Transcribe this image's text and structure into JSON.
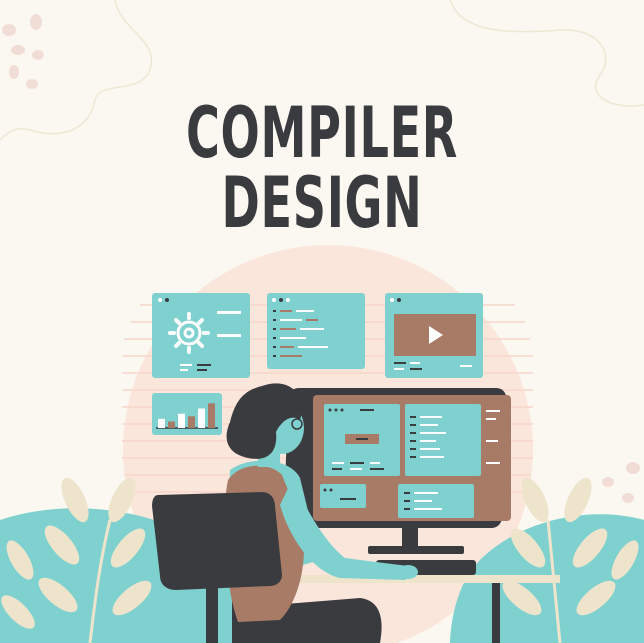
{
  "title": "COMPILER DESIGN",
  "colors": {
    "background": "#fbf8f1",
    "teal": "#7fd1cf",
    "brown": "#a77b66",
    "dark": "#3a3b3f",
    "blush": "#fbe6dc",
    "leaf": "#eee4cc"
  },
  "illustration": {
    "subject": "person-at-computer",
    "floating_panels": [
      "settings-gear-panel",
      "code-panel",
      "video-player-panel",
      "bar-chart-panel"
    ],
    "bar_chart_levels": [
      0.35,
      0.25,
      0.55,
      0.45,
      0.75,
      0.95
    ]
  }
}
